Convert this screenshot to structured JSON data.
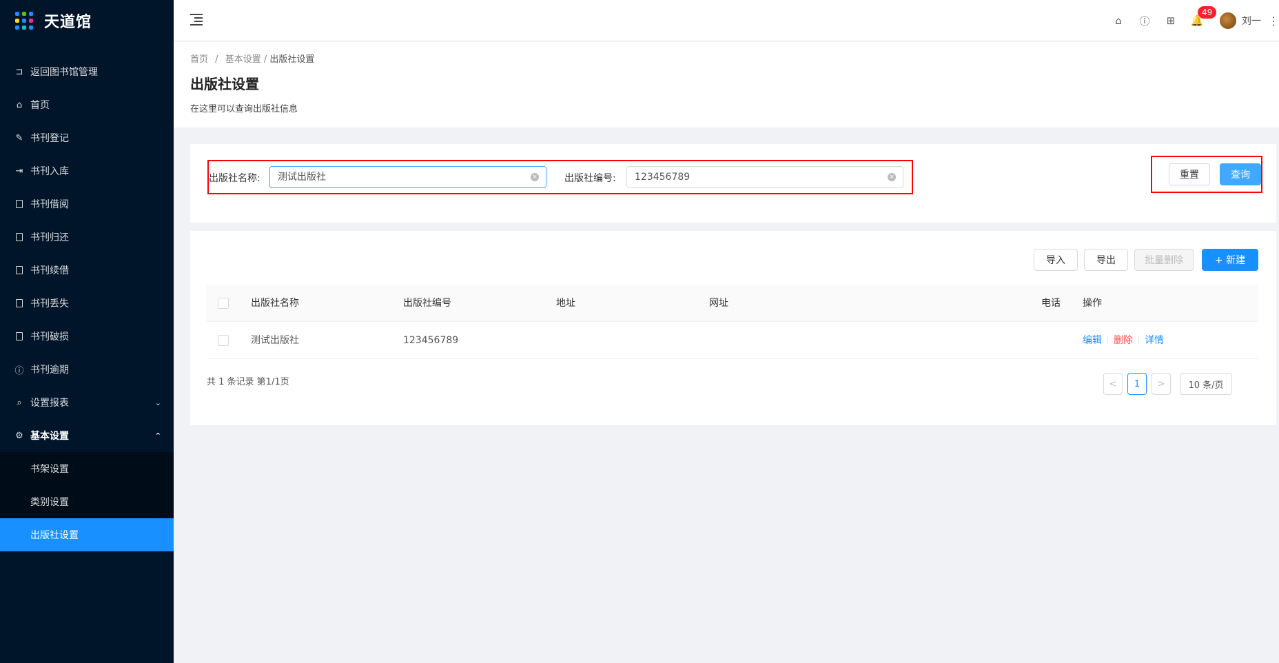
{
  "app": {
    "name": "天道馆"
  },
  "sidebar": {
    "items": [
      {
        "label": "返回图书馆管理",
        "icon": "return-icon"
      },
      {
        "label": "首页",
        "icon": "home-icon"
      },
      {
        "label": "书刊登记",
        "icon": "edit-icon"
      },
      {
        "label": "书刊入库",
        "icon": "import-icon"
      },
      {
        "label": "书刊借阅",
        "icon": "book-icon"
      },
      {
        "label": "书刊归还",
        "icon": "book-icon"
      },
      {
        "label": "书刊续借",
        "icon": "book-icon"
      },
      {
        "label": "书刊丢失",
        "icon": "book-icon"
      },
      {
        "label": "书刊破损",
        "icon": "book-icon"
      },
      {
        "label": "书刊逾期",
        "icon": "warning-icon"
      },
      {
        "label": "设置报表",
        "icon": "report-icon"
      },
      {
        "label": "基本设置",
        "icon": "gear-icon"
      }
    ],
    "submenu": [
      {
        "label": "书架设置"
      },
      {
        "label": "类别设置"
      },
      {
        "label": "出版社设置"
      }
    ]
  },
  "header": {
    "notification_count": "49",
    "user_name": "刘一"
  },
  "breadcrumb": {
    "home": "首页",
    "sep": "/",
    "level2": "基本设置",
    "current": "出版社设置"
  },
  "page": {
    "title": "出版社设置",
    "description": "在这里可以查询出版社信息"
  },
  "search": {
    "name_label": "出版社名称:",
    "name_value": "测试出版社",
    "code_label": "出版社编号:",
    "code_value": "123456789",
    "reset_label": "重置",
    "query_label": "查询"
  },
  "toolbar": {
    "import_label": "导入",
    "export_label": "导出",
    "batch_delete_label": "批量删除",
    "new_label": "+ 新建"
  },
  "table": {
    "columns": [
      "出版社名称",
      "出版社编号",
      "地址",
      "网址",
      "电话",
      "操作"
    ],
    "rows": [
      {
        "name": "测试出版社",
        "code": "123456789",
        "address": "",
        "website": "",
        "phone": "",
        "actions": {
          "edit": "编辑",
          "delete": "删除",
          "detail": "详情"
        }
      }
    ]
  },
  "pagination": {
    "summary": "共 1 条记录 第1/1页",
    "prev": "<",
    "current_page": "1",
    "next": ">",
    "page_size": "10 条/页"
  },
  "colors": {
    "primary": "#1890ff",
    "sidebar_bg": "#001529",
    "danger": "#ff4d4f",
    "highlight_box": "#ff0000"
  }
}
